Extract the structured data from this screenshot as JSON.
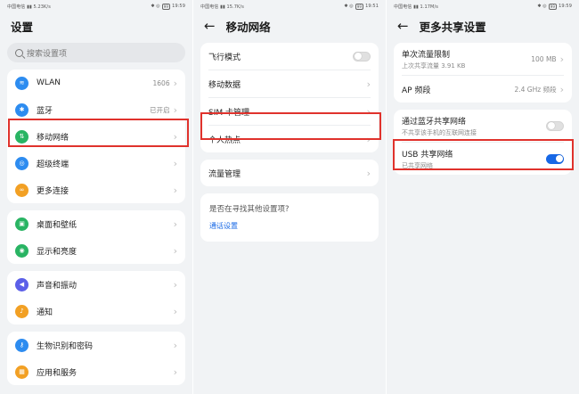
{
  "colors": {
    "accent": "#1768e6",
    "highlight": "#e0322c",
    "wlan": "#2d8cf0",
    "bluetooth": "#2d8cf0",
    "mobile": "#29b463",
    "super_terminal": "#2d8cf0",
    "more_conn": "#f2a024",
    "desktop": "#29b463",
    "display": "#29b463",
    "sound": "#5b5fe8",
    "notify": "#f2a024",
    "bio": "#2d8cf0",
    "apps": "#f2a024"
  },
  "screen1": {
    "status": {
      "carrier": "中国电信",
      "speed": "5.23K/s",
      "battery": "99",
      "time": "19:59"
    },
    "title": "设置",
    "search_placeholder": "搜索设置项",
    "group1": [
      {
        "label": "WLAN",
        "value": "1606",
        "icon": "wifi-icon"
      },
      {
        "label": "蓝牙",
        "value": "已开启",
        "icon": "bluetooth-icon"
      },
      {
        "label": "移动网络",
        "value": "",
        "icon": "signal-icon"
      },
      {
        "label": "超级终端",
        "value": "",
        "icon": "super-terminal-icon"
      },
      {
        "label": "更多连接",
        "value": "",
        "icon": "link-icon"
      }
    ],
    "group2": [
      {
        "label": "桌面和壁纸",
        "icon": "wallpaper-icon"
      },
      {
        "label": "显示和亮度",
        "icon": "eye-icon"
      }
    ],
    "group3": [
      {
        "label": "声音和振动",
        "icon": "speaker-icon"
      },
      {
        "label": "通知",
        "icon": "bell-icon"
      }
    ],
    "group4": [
      {
        "label": "生物识别和密码",
        "icon": "key-icon"
      },
      {
        "label": "应用和服务",
        "icon": "apps-icon"
      }
    ]
  },
  "screen2": {
    "status": {
      "carrier": "中国电信",
      "speed": "15.7K/s",
      "battery": "99",
      "time": "19:51"
    },
    "title": "移动网络",
    "group1": [
      {
        "label": "飞行模式",
        "toggle": false
      },
      {
        "label": "移动数据"
      },
      {
        "label": "SIM 卡管理"
      },
      {
        "label": "个人热点"
      }
    ],
    "group2": [
      {
        "label": "流量管理"
      }
    ],
    "hint": {
      "question": "是否在寻找其他设置项?",
      "link": "通话设置"
    }
  },
  "screen3": {
    "status": {
      "carrier": "中国电信",
      "speed": "1.17M/s",
      "battery": "99",
      "time": "19:59"
    },
    "title": "更多共享设置",
    "group1": [
      {
        "label": "单次流量限制",
        "sub": "上次共享流量 3.91 KB",
        "value": "100 MB"
      },
      {
        "label": "AP 频段",
        "sub": "",
        "value": "2.4 GHz 频段"
      }
    ],
    "group2": [
      {
        "label": "通过蓝牙共享网络",
        "sub": "不共享该手机的互联网连接",
        "toggle": false
      },
      {
        "label": "USB 共享网络",
        "sub": "已共享网络",
        "toggle": true
      }
    ]
  }
}
